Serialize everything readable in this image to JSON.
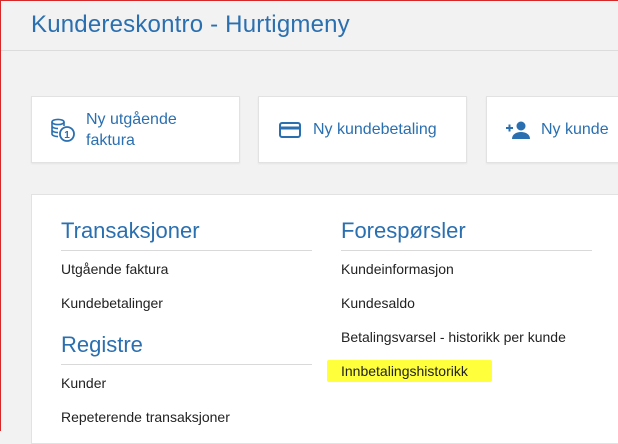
{
  "header": {
    "title": "Kundereskontro - Hurtigmeny"
  },
  "tiles": [
    {
      "label": "Ny utgående faktura",
      "icon": "coins-invoice-icon"
    },
    {
      "label": "Ny kundebetaling",
      "icon": "credit-card-icon"
    },
    {
      "label": "Ny kunde",
      "icon": "add-person-icon"
    }
  ],
  "sections": {
    "transaksjoner": {
      "title": "Transaksjoner",
      "links": [
        "Utgående faktura",
        "Kundebetalinger"
      ]
    },
    "registre": {
      "title": "Registre",
      "links": [
        "Kunder",
        "Repeterende transaksjoner"
      ]
    },
    "foresporsler": {
      "title": "Forespørsler",
      "links": [
        "Kundeinformasjon",
        "Kundesaldo",
        "Betalingsvarsel - historikk per kunde",
        "Innbetalingshistorikk"
      ]
    }
  },
  "colors": {
    "accent": "#2a6fb0",
    "highlight": "#ffff3c",
    "frame": "#d62828"
  }
}
